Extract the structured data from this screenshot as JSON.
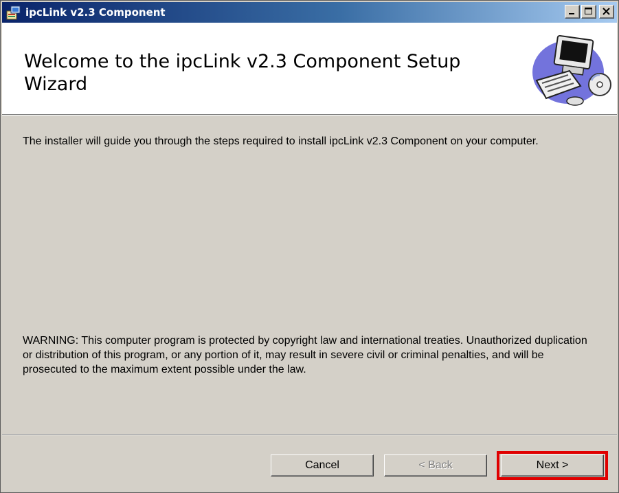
{
  "window": {
    "title": "ipcLink v2.3 Component",
    "icon": "installer-app-icon"
  },
  "title_buttons": {
    "minimize": "minimize-icon",
    "maximize": "maximize-icon",
    "close": "close-icon"
  },
  "header": {
    "title": "Welcome to the ipcLink v2.3 Component Setup Wizard",
    "image": "computer-setup-graphic"
  },
  "content": {
    "intro": "The installer will guide you through the steps required to install ipcLink v2.3 Component on your computer.",
    "warning": "WARNING: This computer program is protected by copyright law and international treaties. Unauthorized duplication or distribution of this program, or any portion of it, may result in severe civil or criminal penalties, and will be prosecuted to the maximum extent possible under the law."
  },
  "buttons": {
    "cancel": "Cancel",
    "back": "< Back",
    "next": "Next >"
  },
  "colors": {
    "titlebar_start": "#0a246a",
    "titlebar_end": "#a6caf0",
    "dialog_bg": "#d4d0c8",
    "highlight": "#e00000"
  }
}
